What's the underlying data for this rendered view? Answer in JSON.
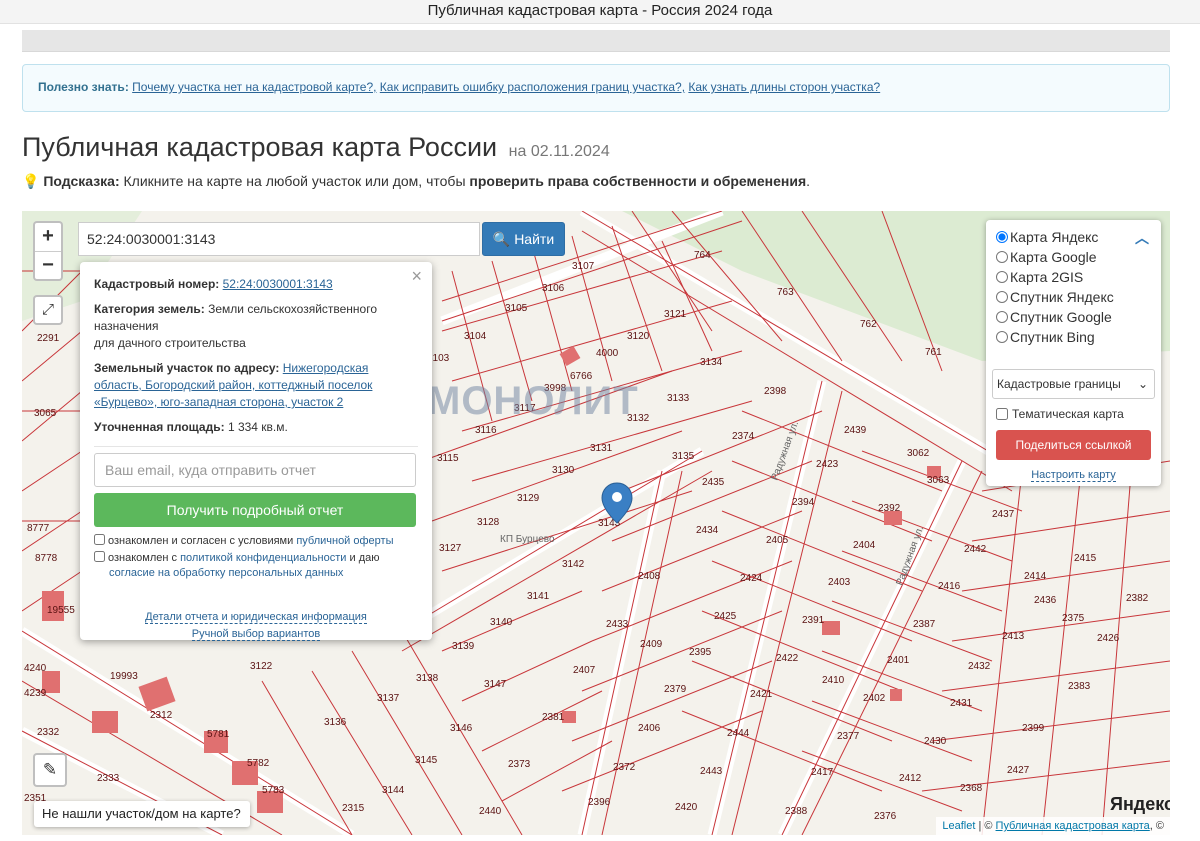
{
  "window": {
    "title": "Публичная кадастровая карта - Россия 2024 года"
  },
  "info": {
    "prefix": "Полезно знать:",
    "link1": "Почему участка нет на кадастровой карте?,",
    "link2": "Как исправить ошибку расположения границ участка?,",
    "link3": "Как узнать длины сторон участка?"
  },
  "page": {
    "title": "Публичная кадастровая карта России",
    "date": "на 02.11.2024",
    "hint_label": "Подсказка:",
    "hint_text": " Кликните на карте на любой участок или дом, чтобы ",
    "hint_bold": "проверить права собственности и обременения",
    "hint_end": "."
  },
  "map": {
    "zoom_in": "+",
    "zoom_out": "−",
    "expand_icon": "⤢",
    "ruler_icon": "✎",
    "search_value": "52:24:0030001:3143",
    "find_button": "Найти",
    "not_found": "Не нашли участок/дом на карте?",
    "yandex_logo": "Яндекс",
    "watermark": "МОНОЛИТ",
    "settlement_label": "КП Бурцево",
    "street_label": "Радужная ул.",
    "attribution": {
      "leaflet": "Leaflet",
      "sep": " | © ",
      "source": "Публичная кадастровая карта",
      "end": ", ©"
    }
  },
  "popup": {
    "close_icon": "×",
    "cad_label": "Кадастровый номер:",
    "cad_value": "52:24:0030001:3143",
    "cat_label": "Категория земель:",
    "cat_value": "Земли сельскохозяйственного назначения",
    "cat_value2": "для дачного строительства",
    "addr_label": "Земельный участок по адресу:",
    "addr_value": "Нижегородская область, Богородский район, коттеджный поселок «Бурцево», юго-западная сторона, участок 2",
    "area_label": "Уточненная площадь:",
    "area_value": "1 334 кв.м.",
    "email_placeholder": "Ваш email, куда отправить отчет",
    "report_button": "Получить подробный отчет",
    "check1_text": "ознакомлен и согласен с условиями ",
    "check1_link": "публичной оферты",
    "check2_text": "ознакомлен с ",
    "check2_link": "политикой конфиденциальности",
    "check2_mid": " и даю",
    "check2_link2": "согласие на обработку персональных данных",
    "details_link": "Детали отчета и юридическая информация",
    "manual_link": "Ручной выбор вариантов"
  },
  "layers": {
    "options": [
      "Карта Яндекс",
      "Карта Google",
      "Карта 2GIS",
      "Спутник Яндекс",
      "Спутник Google",
      "Спутник Bing"
    ],
    "selected": "Карта Яндекс",
    "select_value": "Кадастровые границы",
    "thematic": "Тематическая карта",
    "share_button": "Поделиться ссылкой",
    "configure": "Настроить карту"
  },
  "parcels": [
    "764",
    "763",
    "762",
    "761",
    "3107",
    "3106",
    "3105",
    "3104",
    "3103",
    "3121",
    "3120",
    "4000",
    "6766",
    "3998",
    "3134",
    "3133",
    "3132",
    "3131",
    "3130",
    "3129",
    "3128",
    "3127",
    "3117",
    "3116",
    "3115",
    "3135",
    "3143",
    "3142",
    "3141",
    "3140",
    "3139",
    "3138",
    "3137",
    "3136",
    "3147",
    "3146",
    "3145",
    "3144",
    "3122",
    "2398",
    "2374",
    "2439",
    "2423",
    "2435",
    "2434",
    "2394",
    "2392",
    "2405",
    "2404",
    "2408",
    "2424",
    "2403",
    "2433",
    "2425",
    "2391",
    "2387",
    "2407",
    "2395",
    "2422",
    "2401",
    "2379",
    "2421",
    "2402",
    "2381",
    "2406",
    "2444",
    "2377",
    "2431",
    "2430",
    "2373",
    "2372",
    "2443",
    "2417",
    "2412",
    "2440",
    "2396",
    "2420",
    "2388",
    "2376",
    "2368",
    "2437",
    "2442",
    "2416",
    "2415",
    "2414",
    "2436",
    "2413",
    "2382",
    "2426",
    "2375",
    "2432",
    "2383",
    "2399",
    "2427",
    "3062",
    "3063",
    "2312",
    "2332",
    "2333",
    "2315",
    "5781",
    "5782",
    "5783",
    "2291",
    "3065",
    "8777",
    "8778",
    "19555",
    "19993",
    "4240",
    "4239",
    "2351",
    "2410",
    "2409"
  ]
}
